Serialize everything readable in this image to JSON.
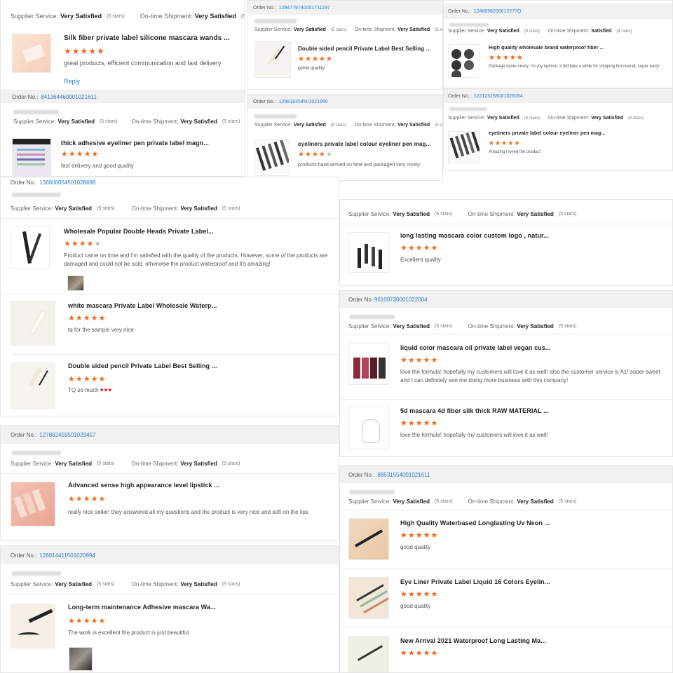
{
  "labels": {
    "order_prefix": "Order No.:",
    "order_prefix_alt": "Order No",
    "supplier": "Supplier Service:",
    "shipment": "On-time Shipment:",
    "very_satisfied": "Very Satisfied",
    "satisfied": "Satisfied",
    "five_stars": "(5 stars)",
    "four_stars": "(4 stars)",
    "reply": "Reply"
  },
  "colors": {
    "accent_orange": "#ee6a1c",
    "link_blue": "#2a7bd0",
    "heart_red": "#d11a1a",
    "bar_gray": "#f1f1f1"
  },
  "rating_glyph": "★",
  "cards": {
    "a": {
      "items": [
        {
          "title": "Silk fiber private label silicone mascara wands ...",
          "rating": 5,
          "comment": "great products, efficient communication and fast delivery"
        }
      ]
    },
    "b": {
      "order_no": "1294779740001711197",
      "items": [
        {
          "title": "Double sided pencil Private Label Best Selling ...",
          "rating": 5,
          "comment": "great quality"
        }
      ]
    },
    "c": {
      "order_no": "1246698200012277O",
      "items": [
        {
          "title": "High quality wholesale brand waterproof fiber ...",
          "rating": 5,
          "comment": "Package came nicely. I'm my opinion, it did take a while for shipping but overall, super easy!"
        }
      ]
    },
    "d": {
      "order_no": "841364460001021611",
      "items": [
        {
          "title": "thick adhesive eyeliner pen private label magn...",
          "rating": 5,
          "comment": "fast delivery and good quality"
        }
      ]
    },
    "e": {
      "order_no": "129819354501021950",
      "items": [
        {
          "title": "eyeliners private label colour eyeliner pen mag...",
          "rating": 4,
          "comment": "products have arrived on time and packaged very nicely!"
        }
      ]
    },
    "f": {
      "order_no": "122123158001026064",
      "items": [
        {
          "title": "eyeliners private label colour eyeliner pen mag...",
          "rating": 5,
          "comment": "Amazing i loved the product"
        }
      ]
    },
    "g": {
      "order_no": "136600054501028698",
      "items": [
        {
          "title": "Wholesale Popular Double Heads Private Label...",
          "rating": 4,
          "comment": "Product came on time and I'm satisfied with the quality of the products. However, some of the products are damaged and could not be sold. otherwise the product waterproof and it's amazing!"
        },
        {
          "title": "white mascara Private Label Wholesale Waterp...",
          "rating": 5,
          "comment": "tq for the sample very nice"
        },
        {
          "title": "Double sided pencil Private Label Best Selling ...",
          "rating": 5,
          "comment": "TQ so much"
        }
      ],
      "hearts": "♥♥♥"
    },
    "h": {
      "items": [
        {
          "title": "long lasting mascara color custom logo , natur...",
          "rating": 5,
          "comment": "Excellent quality"
        }
      ]
    },
    "i": {
      "order_no": "96100730001022004",
      "items": [
        {
          "title": "liquid color mascara oil private label vegan cus...",
          "rating": 5,
          "comment": "love the formula! hopefully my customers will love it as well! also the customer service is A1! super sweet and I can definitely see me doing more business with this company!"
        },
        {
          "title": "5d mascara 4d fiber silk thick RAW MATERIAL ...",
          "rating": 5,
          "comment": "love the formula! hopefully my customers will love it as well!"
        }
      ]
    },
    "j": {
      "order_no": "127862459501029457",
      "items": [
        {
          "title": "Advanced sense high appearance level lipstick ...",
          "rating": 5,
          "comment": "really nice seller! they answered all my questions and the product is very nice and soft on the lips"
        }
      ]
    },
    "k": {
      "order_no": "126014411501020994",
      "items": [
        {
          "title": "Long-term maintenance Adhesive mascara Wa...",
          "rating": 5,
          "comment": "The work is excellent the product is just beautiful"
        }
      ]
    },
    "l": {
      "order_no": "88531554001021611",
      "items": [
        {
          "title": "High Quality Waterbased Longlasting Uv Neon ...",
          "rating": 5,
          "comment": "good quality"
        },
        {
          "title": "Eye Liner Private Label Liquid 16 Colors Eyelin...",
          "rating": 5,
          "comment": "good quality"
        },
        {
          "title": "New Arrival 2021 Waterproof Long Lasting Ma...",
          "rating": 5,
          "comment": ""
        }
      ]
    }
  }
}
